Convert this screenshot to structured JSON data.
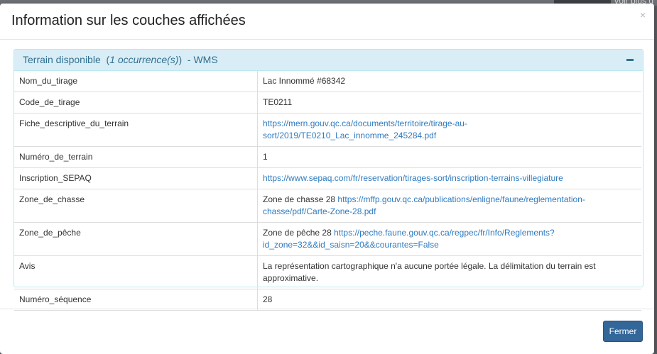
{
  "backdrop": {
    "partial_text": "Voir plus d"
  },
  "modal": {
    "title": "Information sur les couches affichées",
    "close_label": "×",
    "panel": {
      "name": "Terrain disponible",
      "count": "1 occurrence(s)",
      "open_paren": "(",
      "close_paren": ")",
      "suffix": "- WMS"
    },
    "rows": [
      {
        "key": "Nom_du_tirage",
        "text": "Lac Innommé #68342",
        "link": ""
      },
      {
        "key": "Code_de_tirage",
        "text": "TE0211",
        "link": ""
      },
      {
        "key": "Fiche_descriptive_du_terrain",
        "text": "",
        "link": "https://mern.gouv.qc.ca/documents/territoire/tirage-au-sort/2019/TE0210_Lac_innomme_245284.pdf"
      },
      {
        "key": "Numéro_de_terrain",
        "text": "1",
        "link": ""
      },
      {
        "key": "Inscription_SEPAQ",
        "text": "",
        "link": "https://www.sepaq.com/fr/reservation/tirages-sort/inscription-terrains-villegiature"
      },
      {
        "key": "Zone_de_chasse",
        "text": "Zone de chasse 28",
        "link": "https://mffp.gouv.qc.ca/publications/enligne/faune/reglementation-chasse/pdf/Carte-Zone-28.pdf"
      },
      {
        "key": "Zone_de_pêche",
        "text": "Zone de pêche 28",
        "link": "https://peche.faune.gouv.qc.ca/regpec/fr/Info/Reglements?id_zone=32&&id_saisn=20&&courantes=False"
      },
      {
        "key": "Avis",
        "text": "La représentation cartographique n'a aucune portée légale. La délimitation du terrain est approximative.",
        "link": ""
      },
      {
        "key": "Numéro_séquence",
        "text": "28",
        "link": ""
      }
    ],
    "footer": {
      "close_button": "Fermer"
    }
  }
}
